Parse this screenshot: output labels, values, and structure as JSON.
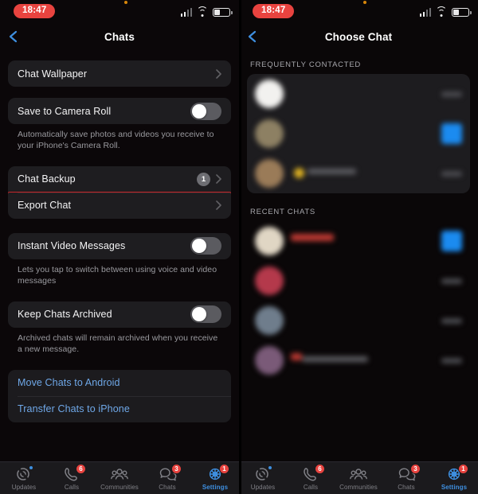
{
  "statusbar": {
    "time": "18:47",
    "signal_icon": "cellular-signal-icon",
    "wifi_icon": "wifi-icon",
    "battery_icon": "battery-icon",
    "recording_dot": "orange-privacy-dot"
  },
  "left_screen": {
    "nav": {
      "back_icon": "back-chevron-icon",
      "title": "Chats"
    },
    "groups": [
      {
        "rows": [
          {
            "label": "Chat Wallpaper",
            "accessory": "chevron",
            "name": "row-chat-wallpaper"
          }
        ]
      },
      {
        "rows": [
          {
            "label": "Save to Camera Roll",
            "accessory": "toggle",
            "toggle_on": false,
            "name": "row-save-to-camera-roll"
          }
        ],
        "footnote": "Automatically save photos and videos you receive to your iPhone's Camera Roll."
      },
      {
        "rows": [
          {
            "label": "Chat Backup",
            "accessory": "badge-chevron",
            "badge": "1",
            "name": "row-chat-backup"
          },
          {
            "label": "Export Chat",
            "accessory": "chevron",
            "name": "row-export-chat",
            "highlighted": true
          }
        ]
      },
      {
        "rows": [
          {
            "label": "Instant Video Messages",
            "accessory": "toggle",
            "toggle_on": false,
            "name": "row-instant-video-messages"
          }
        ],
        "footnote": "Lets you tap to switch between using voice and video messages"
      },
      {
        "rows": [
          {
            "label": "Keep Chats Archived",
            "accessory": "toggle",
            "toggle_on": false,
            "name": "row-keep-chats-archived"
          }
        ],
        "footnote": "Archived chats will remain archived when you receive a new message."
      },
      {
        "rows": [
          {
            "label": "Move Chats to Android",
            "accessory": "none",
            "style": "link",
            "name": "row-move-chats-to-android"
          },
          {
            "label": "Transfer Chats to iPhone",
            "accessory": "none",
            "style": "link",
            "name": "row-transfer-chats-to-iphone"
          }
        ]
      }
    ],
    "highlight_color": "#c8262a"
  },
  "right_screen": {
    "nav": {
      "back_icon": "back-chevron-icon",
      "title": "Choose Chat"
    },
    "sections": [
      {
        "label": "FREQUENTLY CONTACTED",
        "name": "section-frequently-contacted",
        "rows": 3
      },
      {
        "label": "RECENT CHATS",
        "name": "section-recent-chats",
        "rows": 4
      }
    ],
    "content_note": "chat rows are blurred for privacy"
  },
  "tabbar": {
    "accent_color": "#3e8fe0",
    "badge_color": "#e8433f",
    "tabs": [
      {
        "label": "Updates",
        "icon": "updates-icon",
        "badge": "",
        "dot": true,
        "active": false
      },
      {
        "label": "Calls",
        "icon": "calls-icon",
        "badge": "6",
        "dot": false,
        "active": false
      },
      {
        "label": "Communities",
        "icon": "communities-icon",
        "badge": "",
        "dot": false,
        "active": false
      },
      {
        "label": "Chats",
        "icon": "chats-icon",
        "badge": "3",
        "dot": false,
        "active": false
      },
      {
        "label": "Settings",
        "icon": "settings-gear-icon",
        "badge": "1",
        "dot": false,
        "active": true
      }
    ]
  }
}
